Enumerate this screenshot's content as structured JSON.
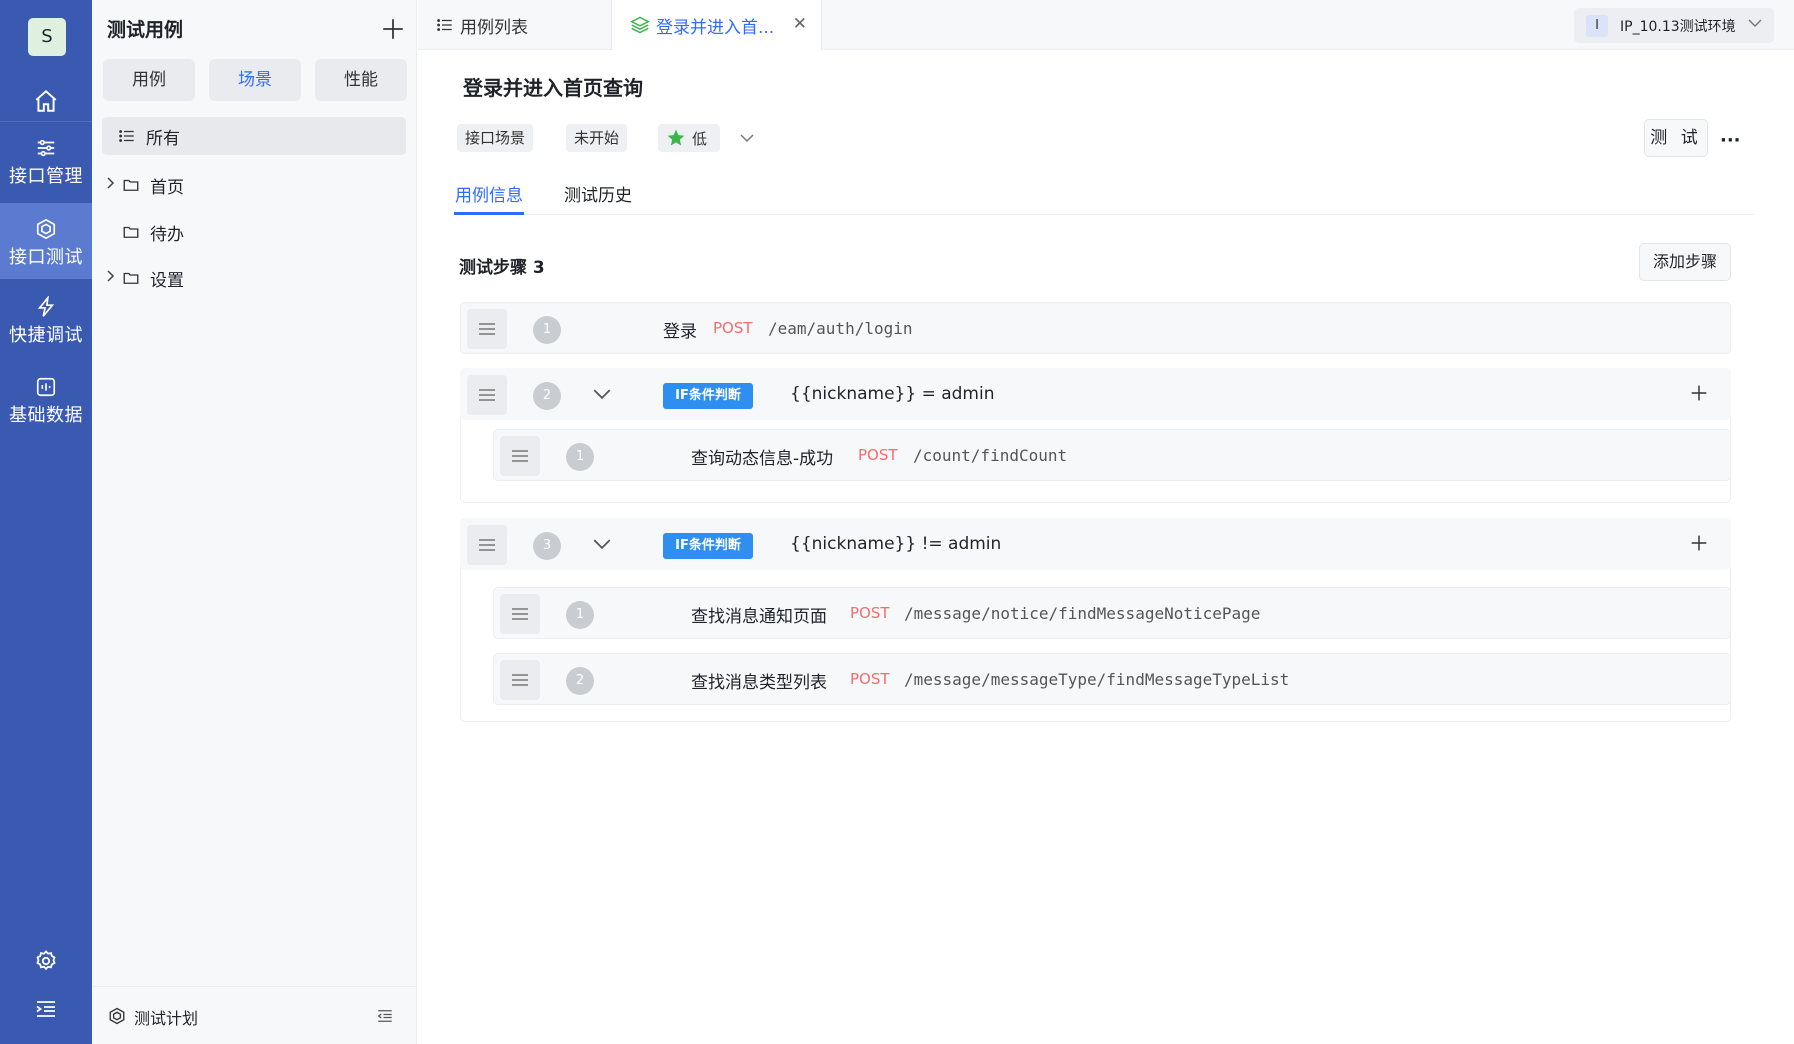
{
  "rail": {
    "avatar": "S",
    "items": [
      {
        "label": "接口管理",
        "icon": "sliders-icon"
      },
      {
        "label": "接口测试",
        "icon": "cube-icon"
      },
      {
        "label": "快捷调试",
        "icon": "lightning-icon"
      },
      {
        "label": "基础数据",
        "icon": "data-icon"
      }
    ]
  },
  "tree": {
    "title": "测试用例",
    "segments": [
      "用例",
      "场景",
      "性能"
    ],
    "active_segment": "场景",
    "items": [
      {
        "label": "所有",
        "icon": "list-icon"
      },
      {
        "label": "首页",
        "icon": "folder-icon"
      },
      {
        "label": "待办",
        "icon": "folder-icon"
      },
      {
        "label": "设置",
        "icon": "folder-icon"
      }
    ],
    "footer_label": "测试计划"
  },
  "tabs": {
    "list_label": "用例列表",
    "scene_label": "登录并进入首...",
    "close": "✕"
  },
  "env": {
    "badge": "I",
    "label": "IP_10.13测试环境"
  },
  "case": {
    "title": "登录并进入首页查询",
    "type_chip": "接口场景",
    "status_chip": "未开始",
    "priority": "低",
    "priority_color": "#3bb54a",
    "test_button": "测 试",
    "more": "···",
    "subtabs": [
      "用例信息",
      "测试历史"
    ],
    "steps_title": "测试步骤 3",
    "add_step_button": "添加步骤"
  },
  "steps": {
    "step1": {
      "num": "1",
      "name": "登录",
      "method": "POST",
      "path": "/eam/auth/login"
    },
    "step2": {
      "num": "2",
      "badge": "IF条件判断",
      "condition": "{{nickname}} = admin",
      "children": [
        {
          "num": "1",
          "name": "查询动态信息-成功",
          "method": "POST",
          "path": "/count/findCount"
        }
      ]
    },
    "step3": {
      "num": "3",
      "badge": "IF条件判断",
      "condition": "{{nickname}} != admin",
      "children": [
        {
          "num": "1",
          "name": "查找消息通知页面",
          "method": "POST",
          "path": "/message/notice/findMessageNoticePage"
        },
        {
          "num": "2",
          "name": "查找消息类型列表",
          "method": "POST",
          "path": "/message/messageType/findMessageTypeList"
        }
      ]
    }
  },
  "colors": {
    "rail_bg": "#3a5ab1",
    "rail_active": "#5a7bd0",
    "accent": "#2f6bff",
    "method_post": "#f56c6c",
    "if_badge": "#2f8ff0"
  }
}
